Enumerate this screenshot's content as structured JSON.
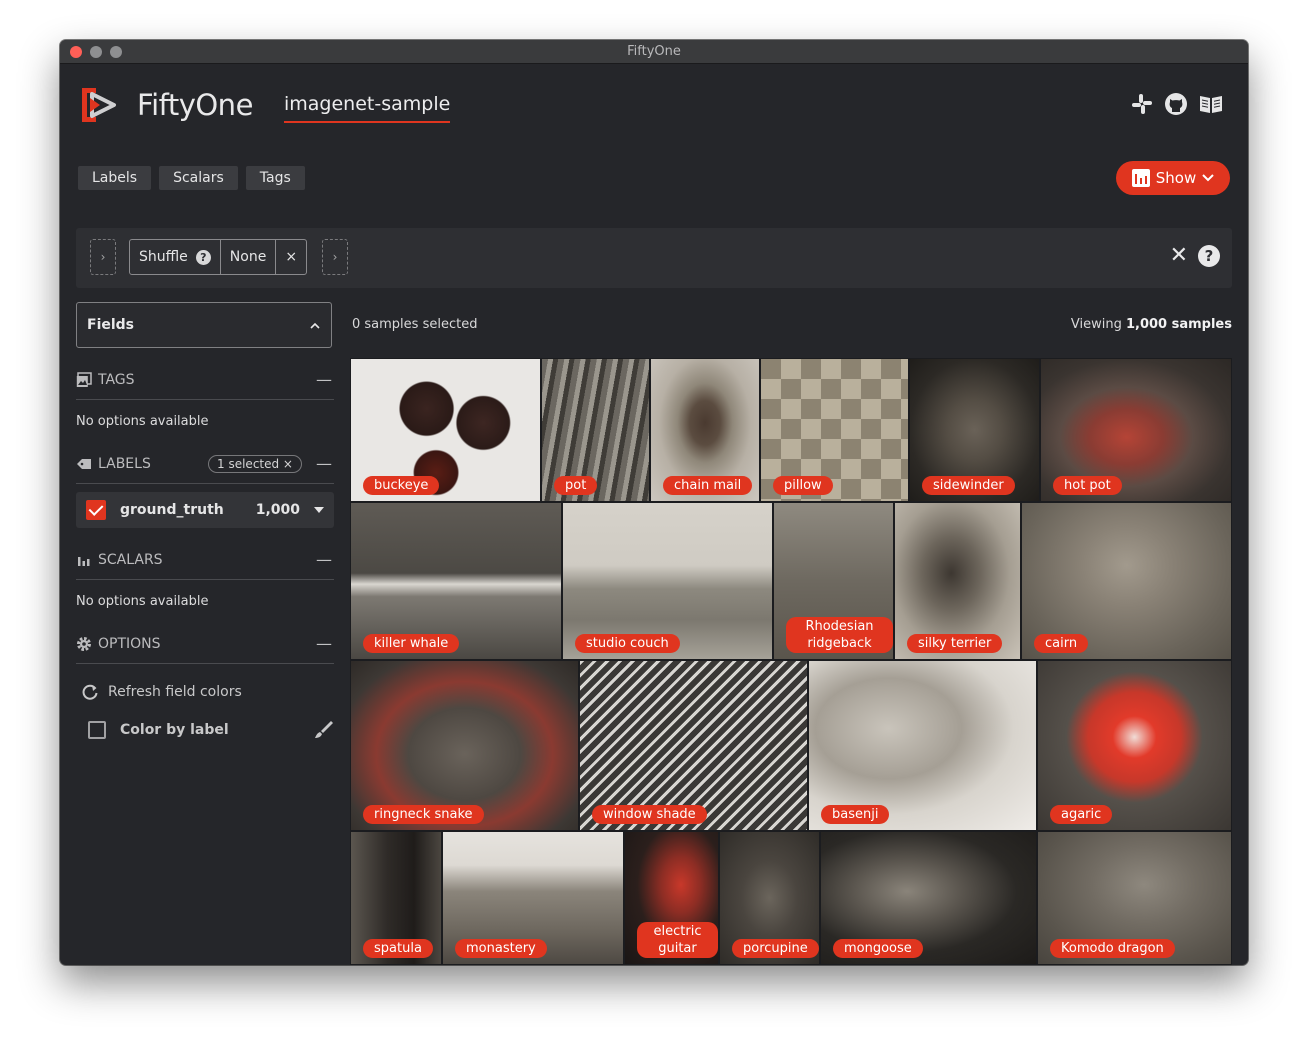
{
  "window": {
    "title": "FiftyOne"
  },
  "header": {
    "brand": "FiftyOne",
    "dataset": "imagenet-sample"
  },
  "tabs": [
    {
      "label": "Labels"
    },
    {
      "label": "Scalars"
    },
    {
      "label": "Tags"
    }
  ],
  "show_button": {
    "label": "Show"
  },
  "viewbar": {
    "stage": {
      "name": "Shuffle",
      "help": "?",
      "value": "None",
      "remove": "×"
    },
    "add_left": "›",
    "add_right": "›",
    "close": "✕",
    "help": "?"
  },
  "sidebar": {
    "fields_title": "Fields",
    "tags": {
      "title": "TAGS",
      "empty": "No options available"
    },
    "labels": {
      "title": "LABELS",
      "selected": "1 selected ×",
      "items": [
        {
          "name": "ground_truth",
          "count": "1,000"
        }
      ]
    },
    "scalars": {
      "title": "SCALARS",
      "empty": "No options available"
    },
    "options": {
      "title": "OPTIONS",
      "refresh": "Refresh field colors",
      "color_by_label": "Color by label"
    }
  },
  "grid": {
    "selected_text": "0 samples selected",
    "viewing_prefix": "Viewing ",
    "viewing_count": "1,000 samples",
    "tiles": [
      {
        "label": "buckeye"
      },
      {
        "label": "pot"
      },
      {
        "label": "chain mail"
      },
      {
        "label": "pillow"
      },
      {
        "label": "sidewinder"
      },
      {
        "label": "hot pot"
      },
      {
        "label": "killer whale"
      },
      {
        "label": "studio couch"
      },
      {
        "label": "Rhodesian ridgeback"
      },
      {
        "label": "silky terrier"
      },
      {
        "label": "cairn"
      },
      {
        "label": "ringneck snake"
      },
      {
        "label": "window shade"
      },
      {
        "label": "basenji"
      },
      {
        "label": "agaric"
      },
      {
        "label": "spatula"
      },
      {
        "label": "monastery"
      },
      {
        "label": "electric guitar"
      },
      {
        "label": "porcupine"
      },
      {
        "label": "mongoose"
      },
      {
        "label": "Komodo dragon"
      }
    ]
  },
  "colors": {
    "accent": "#e0351f",
    "background": "#25262a",
    "panel": "#2e2f33"
  }
}
